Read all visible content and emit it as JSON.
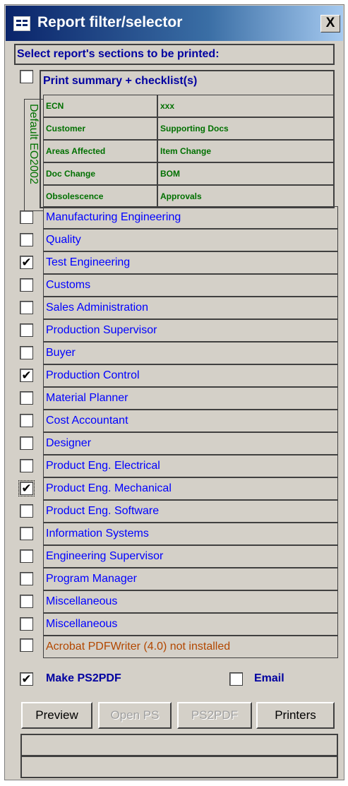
{
  "window": {
    "title": "Report filter/selector",
    "close_label": "X"
  },
  "sections_header": "Select report's sections to be printed:",
  "summary": {
    "label": "Print summary + checklist(s)",
    "checked": false,
    "vertical_label": "Default EO2002",
    "grid": [
      [
        "ECN",
        "xxx"
      ],
      [
        "Customer",
        "Supporting Docs"
      ],
      [
        "Areas Affected",
        "Item Change"
      ],
      [
        "Doc Change",
        "BOM"
      ],
      [
        "Obsolescence",
        "Approvals"
      ]
    ]
  },
  "departments": [
    {
      "label": "Manufacturing Engineering",
      "checked": false
    },
    {
      "label": "Quality",
      "checked": false
    },
    {
      "label": "Test Engineering",
      "checked": true
    },
    {
      "label": "Customs",
      "checked": false
    },
    {
      "label": "Sales Administration",
      "checked": false
    },
    {
      "label": "Production Supervisor",
      "checked": false
    },
    {
      "label": "Buyer",
      "checked": false
    },
    {
      "label": "Production Control",
      "checked": true
    },
    {
      "label": "Material Planner",
      "checked": false
    },
    {
      "label": "Cost Accountant",
      "checked": false
    },
    {
      "label": "Designer",
      "checked": false
    },
    {
      "label": "Product Eng. Electrical",
      "checked": false
    },
    {
      "label": "Product Eng. Mechanical",
      "checked": true,
      "focused": true
    },
    {
      "label": "Product Eng. Software",
      "checked": false
    },
    {
      "label": "Information Systems",
      "checked": false
    },
    {
      "label": "Engineering Supervisor",
      "checked": false
    },
    {
      "label": "Program Manager",
      "checked": false
    },
    {
      "label": "Miscellaneous",
      "checked": false
    },
    {
      "label": "Miscellaneous",
      "checked": false
    }
  ],
  "pdfwriter_status": "Acrobat PDFWriter (4.0) not installed",
  "options": {
    "make_ps2pdf": {
      "label": "Make PS2PDF",
      "checked": true
    },
    "email": {
      "label": "Email",
      "checked": false
    }
  },
  "buttons": {
    "preview": "Preview",
    "open_ps": "Open PS",
    "ps2pdf": "PS2PDF",
    "printers": "Printers"
  },
  "colors": {
    "title_start": "#0a246a",
    "title_end": "#a6caf0",
    "dept_text": "#0000ff",
    "grid_text": "#007000",
    "warning_text": "#b24700"
  }
}
